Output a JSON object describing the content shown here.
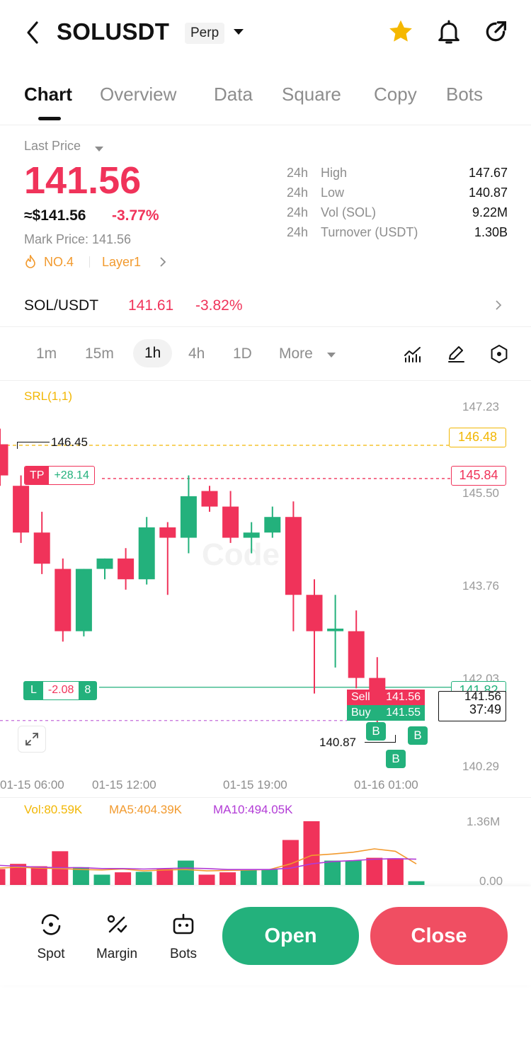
{
  "header": {
    "symbol": "SOLUSDT",
    "contract_type": "Perp",
    "icons": [
      "back-icon",
      "star-icon",
      "bell-icon",
      "share-icon"
    ],
    "star_color": "#f5b800"
  },
  "tabs": [
    "Chart",
    "Overview",
    "Data",
    "Square",
    "Copy",
    "Bots"
  ],
  "price": {
    "last_price_label": "Last Price",
    "last_price": "141.56",
    "usd_price": "≈$141.56",
    "change": "-3.77%",
    "mark_price": "Mark Price:  141.56",
    "rank": "NO.4",
    "tag": "Layer1"
  },
  "stats": [
    {
      "period": "24h",
      "name": "High",
      "value": "147.67"
    },
    {
      "period": "24h",
      "name": "Low",
      "value": "140.87"
    },
    {
      "period": "24h",
      "name": "Vol (SOL)",
      "value": "9.22M"
    },
    {
      "period": "24h",
      "name": "Turnover (USDT)",
      "value": "1.30B"
    }
  ],
  "spot": {
    "pair": "SOL/USDT",
    "price": "141.61",
    "change": "-3.82%"
  },
  "timeframes": {
    "items": [
      "1m",
      "15m",
      "1h",
      "4h",
      "1D"
    ],
    "active": "1h",
    "more": "More"
  },
  "chart": {
    "indicator": "SRL(1,1)",
    "price_axis": [
      "147.23",
      "145.50",
      "143.76",
      "142.03",
      "140.29"
    ],
    "high_marker": "146.45",
    "srl_line": "146.48",
    "tp_label": "TP",
    "tp_pnl": "+28.14",
    "tp_price": "145.84",
    "pos_label": "L",
    "pos_pnl": "-2.08",
    "pos_leverage": "8",
    "pos_price": "141.82",
    "sell_label": "Sell",
    "sell_price": "141.56",
    "buy_label": "Buy",
    "buy_price": "141.55",
    "last_price_hidden": "141.56",
    "countdown": "37:49",
    "low_marker": "140.87",
    "trade_marker": "B",
    "time_axis": [
      "01-15 06:00",
      "01-15 12:00",
      "01-15 19:00",
      "01-16 01:00"
    ],
    "up_color": "#23b17c",
    "down_color": "#f0335a"
  },
  "chart_data": {
    "type": "candlestick",
    "ylim": [
      140.29,
      147.23
    ],
    "candles": [
      {
        "o": 146.5,
        "h": 146.8,
        "c": 145.9,
        "l": 145.7
      },
      {
        "o": 145.7,
        "h": 145.9,
        "c": 144.8,
        "l": 144.6
      },
      {
        "o": 144.8,
        "h": 145.2,
        "c": 144.2,
        "l": 144.0
      },
      {
        "o": 144.1,
        "h": 144.3,
        "c": 142.9,
        "l": 142.7
      },
      {
        "o": 142.9,
        "h": 144.1,
        "c": 144.1,
        "l": 142.8
      },
      {
        "o": 144.1,
        "h": 144.3,
        "c": 144.3,
        "l": 143.9
      },
      {
        "o": 144.3,
        "h": 144.5,
        "c": 143.9,
        "l": 143.7
      },
      {
        "o": 143.9,
        "h": 145.1,
        "c": 144.9,
        "l": 143.8
      },
      {
        "o": 144.9,
        "h": 145.0,
        "c": 144.7,
        "l": 143.6
      },
      {
        "o": 144.7,
        "h": 145.9,
        "c": 145.5,
        "l": 144.4
      },
      {
        "o": 145.6,
        "h": 145.7,
        "c": 145.3,
        "l": 145.2
      },
      {
        "o": 145.3,
        "h": 145.6,
        "c": 144.7,
        "l": 144.6
      },
      {
        "o": 144.7,
        "h": 145.0,
        "c": 144.8,
        "l": 144.4
      },
      {
        "o": 144.8,
        "h": 145.3,
        "c": 145.1,
        "l": 144.7
      },
      {
        "o": 145.1,
        "h": 145.4,
        "c": 143.6,
        "l": 142.9
      },
      {
        "o": 143.6,
        "h": 143.9,
        "c": 142.9,
        "l": 141.7
      },
      {
        "o": 142.9,
        "h": 143.6,
        "c": 142.95,
        "l": 142.2
      },
      {
        "o": 142.9,
        "h": 143.3,
        "c": 142.0,
        "l": 141.8
      },
      {
        "o": 142.0,
        "h": 142.4,
        "c": 141.56,
        "l": 140.87
      }
    ],
    "volume_ylim": [
      0,
      1.36
    ],
    "volumes_m": [
      0.34,
      0.45,
      0.4,
      0.72,
      0.38,
      0.22,
      0.27,
      0.28,
      0.34,
      0.52,
      0.22,
      0.27,
      0.34,
      0.33,
      0.96,
      1.36,
      0.52,
      0.52,
      0.58,
      0.57,
      0.08
    ],
    "volume_colors": [
      "down",
      "down",
      "down",
      "down",
      "up",
      "up",
      "down",
      "up",
      "down",
      "up",
      "down",
      "down",
      "up",
      "up",
      "down",
      "down",
      "up",
      "up",
      "down",
      "down",
      "up"
    ],
    "ma5": [
      0.36,
      0.38,
      0.36,
      0.35,
      0.33,
      0.32,
      0.34,
      0.3,
      0.32,
      0.33,
      0.3,
      0.31,
      0.32,
      0.33,
      0.45,
      0.63,
      0.66,
      0.7,
      0.77,
      0.72,
      0.45
    ],
    "ma10": [
      0.42,
      0.4,
      0.38,
      0.37,
      0.37,
      0.35,
      0.35,
      0.34,
      0.35,
      0.36,
      0.35,
      0.33,
      0.33,
      0.33,
      0.36,
      0.45,
      0.5,
      0.52,
      0.55,
      0.56,
      0.55
    ]
  },
  "volume": {
    "vol": "Vol:80.59K",
    "ma5": "MA5:404.39K",
    "ma10": "MA10:494.05K",
    "axis_top": "1.36M",
    "axis_bottom": "0.00",
    "vol_color": "#f2b705",
    "ma5_color": "#f29a2e",
    "ma10_color": "#b23bd6"
  },
  "bottom_nav": {
    "spot": "Spot",
    "margin": "Margin",
    "bots": "Bots",
    "open": "Open",
    "close": "Close"
  }
}
